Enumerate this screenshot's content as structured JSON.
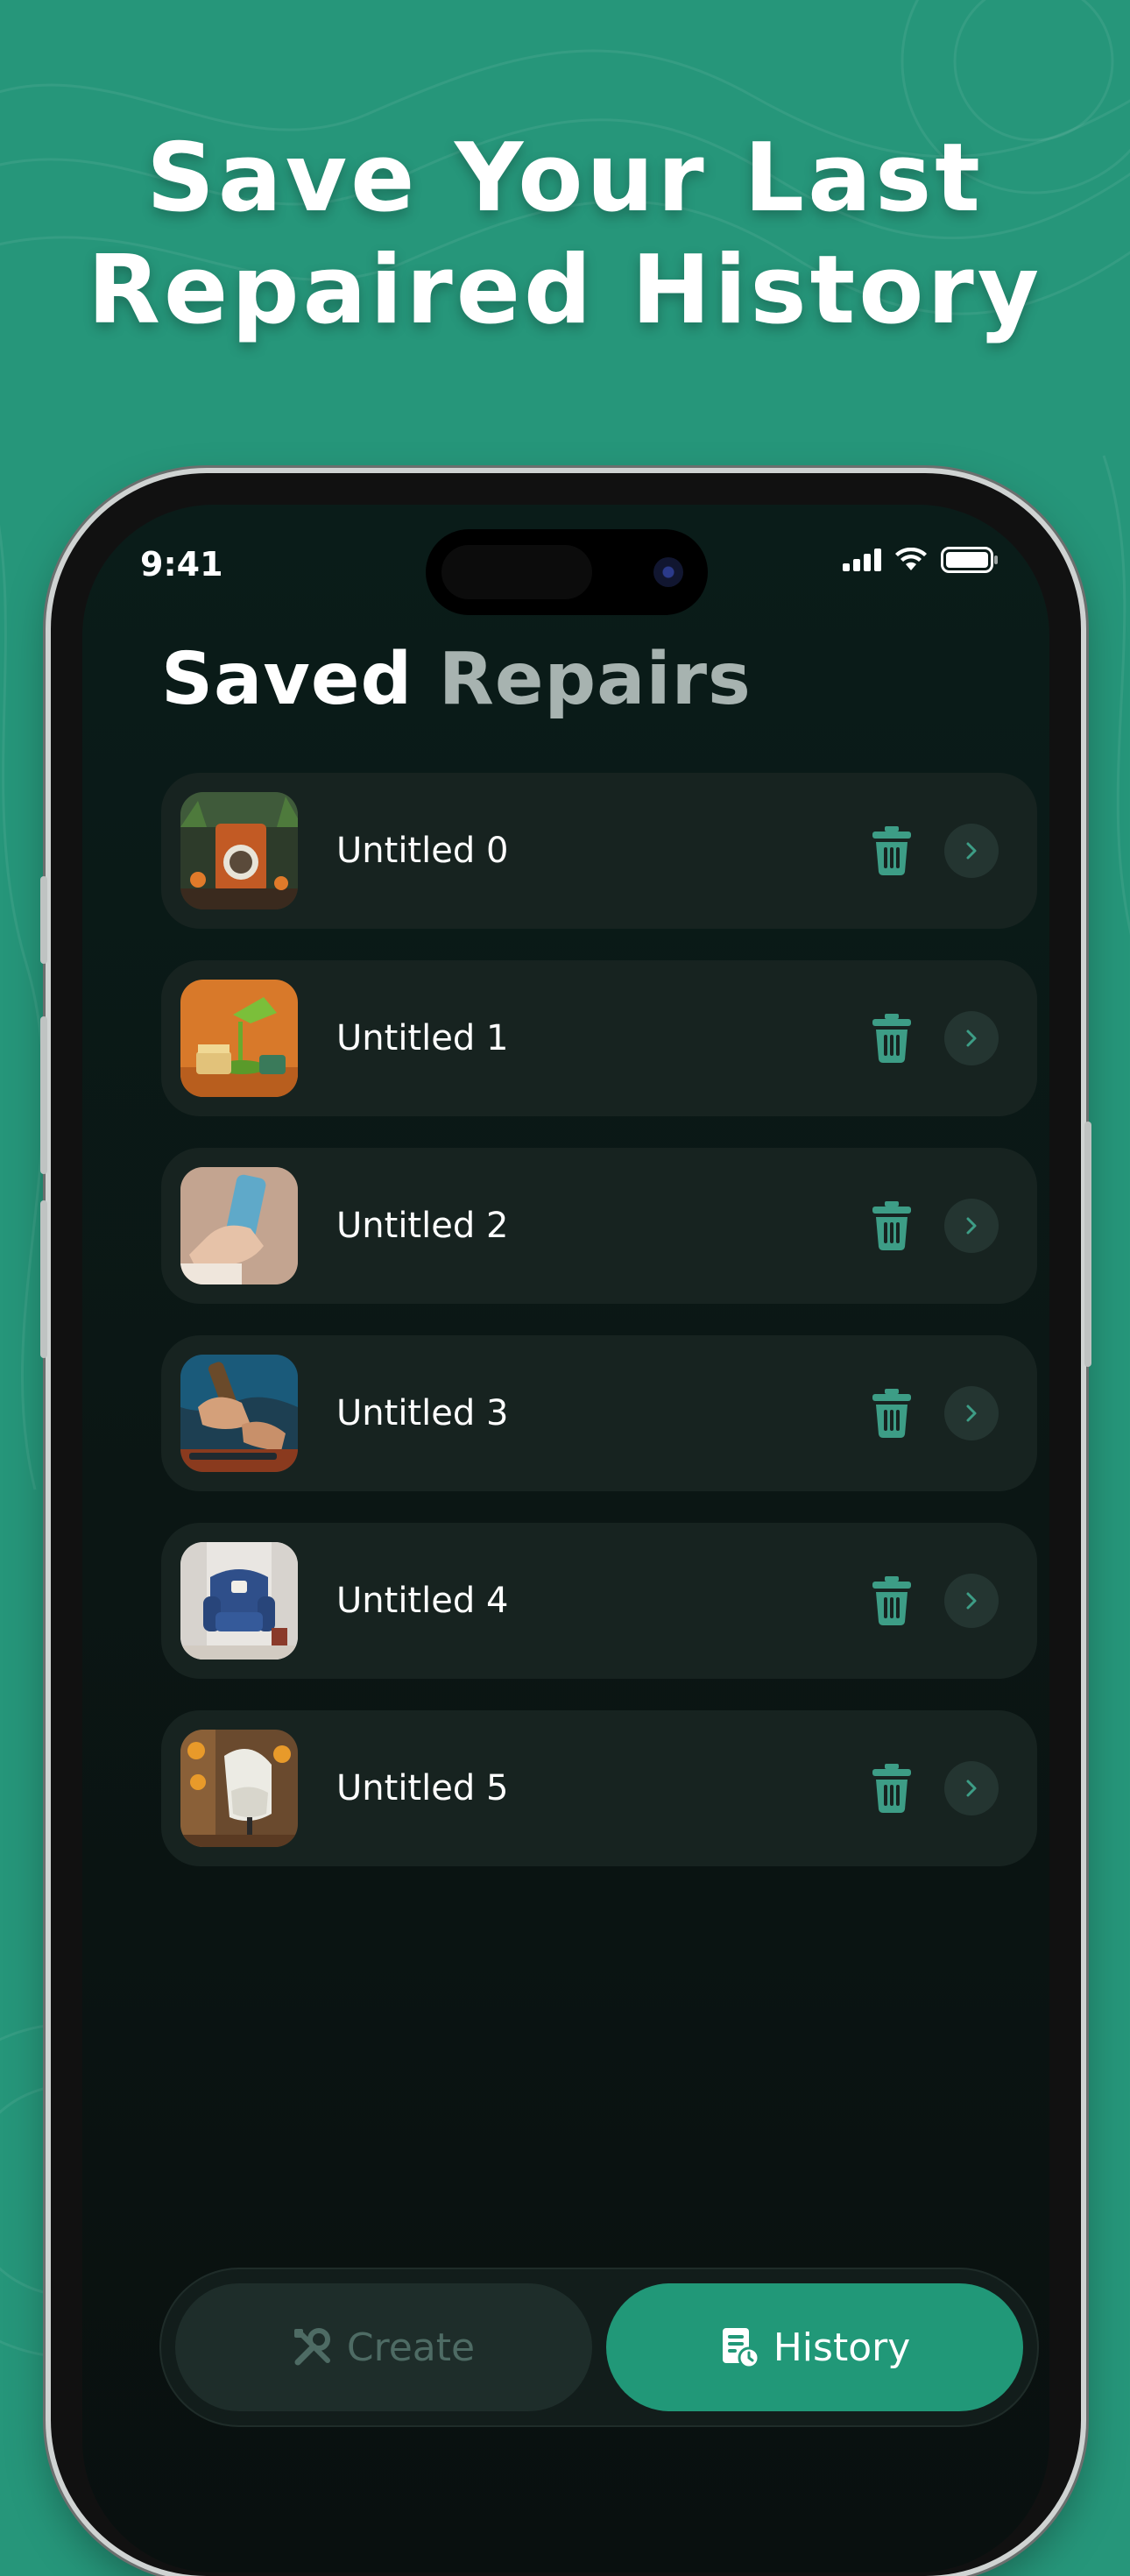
{
  "headline": {
    "line1": "Save Your Last",
    "line2": "Repaired History"
  },
  "status_bar": {
    "time": "9:41"
  },
  "page": {
    "title_part1": "Saved",
    "title_part2": "Repairs"
  },
  "repairs": [
    {
      "label": "Untitled 0",
      "thumb": "washing-machine"
    },
    {
      "label": "Untitled 1",
      "thumb": "desk-lamp"
    },
    {
      "label": "Untitled 2",
      "thumb": "smartphone-in-hand"
    },
    {
      "label": "Untitled 3",
      "thumb": "screwdriver-repair"
    },
    {
      "label": "Untitled 4",
      "thumb": "blue-armchair"
    },
    {
      "label": "Untitled 5",
      "thumb": "white-egg-chair"
    }
  ],
  "tabs": {
    "create": {
      "label": "Create",
      "icon": "tools-icon",
      "active": false
    },
    "history": {
      "label": "History",
      "icon": "history-document-icon",
      "active": true
    }
  },
  "colors": {
    "background": "#26967a",
    "accent": "#219878",
    "card": "#172320",
    "icon_teal": "#3d9d86"
  }
}
